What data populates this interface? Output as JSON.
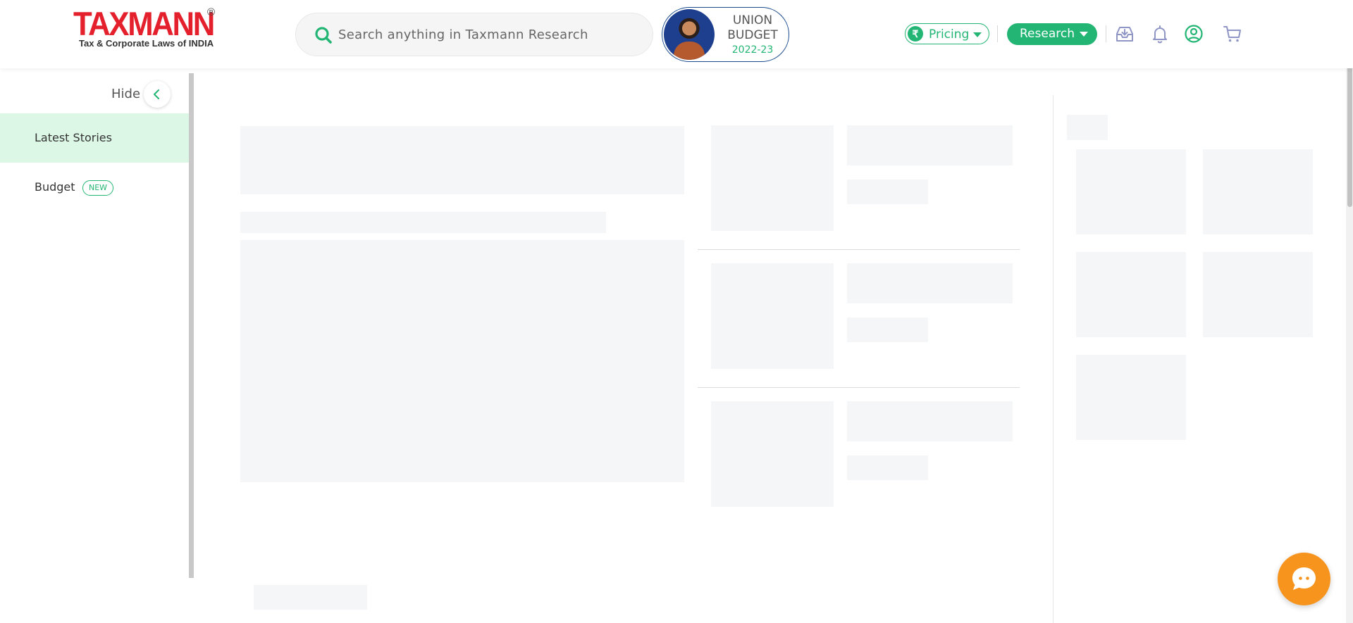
{
  "header": {
    "logo": {
      "word": "TAXMANN",
      "registered": "®",
      "tagline": "Tax & Corporate Laws of INDIA"
    },
    "search": {
      "placeholder": "Search anything in Taxmann Research",
      "value": "",
      "icon": "search-icon"
    },
    "budget_banner": {
      "line1": "UNION",
      "line2": "BUDGET",
      "line3": "2022-23"
    },
    "pricing": {
      "symbol": "₹",
      "label": "Pricing"
    },
    "research": {
      "label": "Research"
    },
    "icons": [
      "inbox-download-icon",
      "bell-icon",
      "user-circle-icon",
      "cart-icon"
    ]
  },
  "sidebar": {
    "hide_label": "Hide",
    "items": [
      {
        "label": "Latest Stories",
        "active": true
      },
      {
        "label": "Budget",
        "badge": "NEW",
        "active": false
      }
    ]
  },
  "colors": {
    "brand_red": "#e3202b",
    "accent_green": "#22b573",
    "active_bg": "#dcf7e6",
    "budget_border": "#1a4a8c",
    "chat_orange": "#f7941d",
    "skeleton": "#f5f6f7"
  }
}
